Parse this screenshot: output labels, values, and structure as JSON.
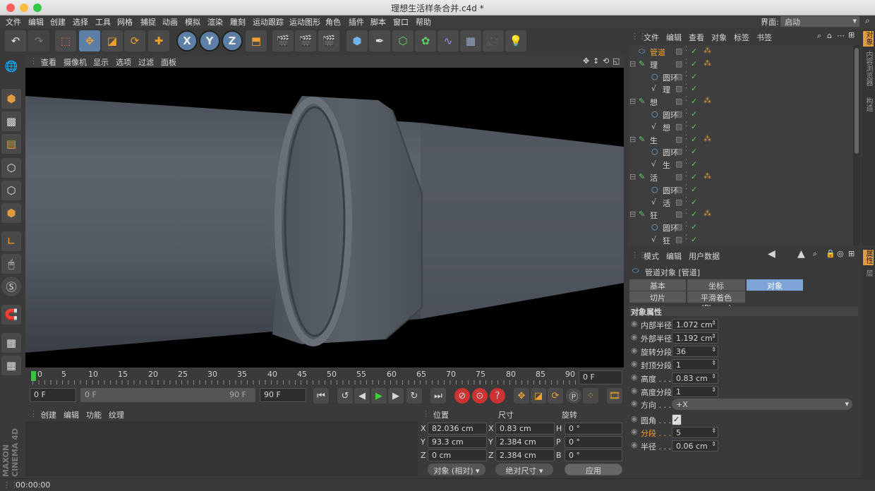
{
  "window": {
    "title": "理想生活样条合并.c4d *"
  },
  "menu": [
    "文件",
    "编辑",
    "创建",
    "选择",
    "工具",
    "网格",
    "捕捉",
    "动画",
    "模拟",
    "渲染",
    "雕刻",
    "运动跟踪",
    "运动图形",
    "角色",
    "插件",
    "脚本",
    "窗口",
    "帮助"
  ],
  "layout": {
    "label": "界面:",
    "value": "启动"
  },
  "toolbar": {
    "x": "X",
    "y": "Y",
    "z": "Z"
  },
  "viewport": {
    "menu": [
      "查看",
      "摄像机",
      "显示",
      "选项",
      "过滤",
      "面板"
    ]
  },
  "timeline": {
    "ticks": [
      "0",
      "5",
      "10",
      "15",
      "20",
      "25",
      "30",
      "35",
      "40",
      "45",
      "50",
      "55",
      "60",
      "65",
      "70",
      "75",
      "80",
      "85",
      "90"
    ],
    "current": "0 F"
  },
  "playback": {
    "start": "0 F",
    "range_start": "0 F",
    "range_end": "90 F",
    "end": "90 F"
  },
  "material": {
    "menu": [
      "创建",
      "编辑",
      "功能",
      "纹理"
    ]
  },
  "coords": {
    "headers": [
      "位置",
      "尺寸",
      "旋转"
    ],
    "rows": [
      {
        "a": "X",
        "pos": "82.036 cm",
        "b": "X",
        "size": "0.83 cm",
        "c": "H",
        "rot": "0 °"
      },
      {
        "a": "Y",
        "pos": "93.3 cm",
        "b": "Y",
        "size": "2.384 cm",
        "c": "P",
        "rot": "0 °"
      },
      {
        "a": "Z",
        "pos": "0 cm",
        "b": "Z",
        "size": "2.384 cm",
        "c": "B",
        "rot": "0 °"
      }
    ],
    "mode": "对象 (相对)",
    "size_mode": "绝对尺寸",
    "apply": "应用"
  },
  "objects": {
    "menu": [
      "文件",
      "编辑",
      "查看",
      "对象",
      "标签",
      "书签"
    ],
    "items": [
      {
        "name": "管道",
        "indent": 0,
        "kind": "tube",
        "selected": true
      },
      {
        "name": "理",
        "indent": 0,
        "kind": "group"
      },
      {
        "name": "圆环",
        "indent": 1,
        "kind": "circle"
      },
      {
        "name": "理",
        "indent": 1,
        "kind": "spline"
      },
      {
        "name": "想",
        "indent": 0,
        "kind": "group"
      },
      {
        "name": "圆环",
        "indent": 1,
        "kind": "circle"
      },
      {
        "name": "想",
        "indent": 1,
        "kind": "spline"
      },
      {
        "name": "生",
        "indent": 0,
        "kind": "group"
      },
      {
        "name": "圆环",
        "indent": 1,
        "kind": "circle"
      },
      {
        "name": "生",
        "indent": 1,
        "kind": "spline"
      },
      {
        "name": "活",
        "indent": 0,
        "kind": "group"
      },
      {
        "name": "圆环",
        "indent": 1,
        "kind": "circle"
      },
      {
        "name": "活",
        "indent": 1,
        "kind": "spline"
      },
      {
        "name": "狂",
        "indent": 0,
        "kind": "group"
      },
      {
        "name": "圆环",
        "indent": 1,
        "kind": "circle"
      },
      {
        "name": "狂",
        "indent": 1,
        "kind": "spline"
      }
    ]
  },
  "attributes": {
    "menu": [
      "模式",
      "编辑",
      "用户数据"
    ],
    "object_title": "管道对象 [管道]",
    "tabs": [
      "基本",
      "坐标",
      "对象",
      "切片",
      "平滑着色(Phong)"
    ],
    "section": "对象属性",
    "fields": [
      {
        "label": "内部半径",
        "value": "1.072 cm"
      },
      {
        "label": "外部半径",
        "value": "1.192 cm"
      },
      {
        "label": "旋转分段",
        "value": "36"
      },
      {
        "label": "封顶分段",
        "value": "1"
      },
      {
        "label": "高度 . . .",
        "value": "0.83 cm"
      },
      {
        "label": "高度分段",
        "value": "1"
      },
      {
        "label": "方向 . . .",
        "value": "+X"
      },
      {
        "label": "圆角 . . .",
        "value": "✓"
      },
      {
        "label": "分段 . . .",
        "value": "5"
      },
      {
        "label": "半径 . . .",
        "value": "0.06 cm"
      }
    ]
  },
  "side_tabs": {
    "top": [
      "对象",
      "内容浏览器",
      "构造"
    ],
    "bottom": [
      "属性",
      "层"
    ]
  },
  "brand": "MAXON CINEMA 4D",
  "status": {
    "time": "00:00:00"
  }
}
